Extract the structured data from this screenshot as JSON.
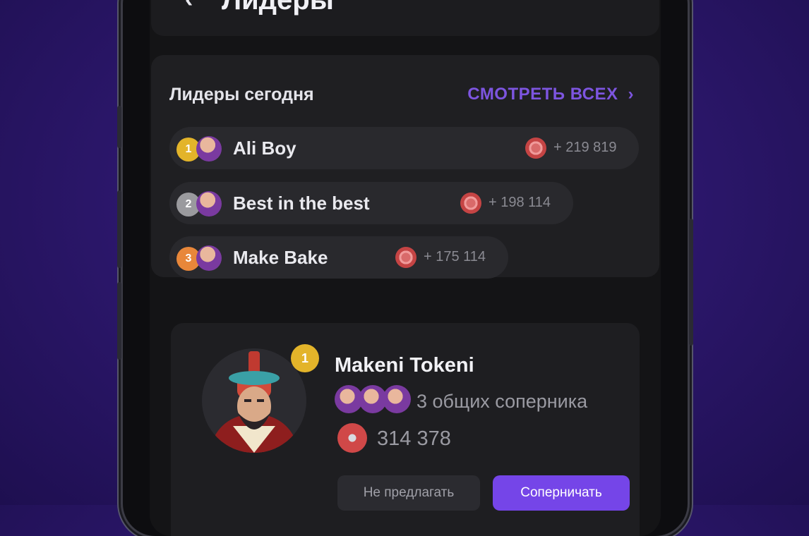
{
  "header": {
    "back_icon": "chevron-left-icon",
    "title": "Лидеры"
  },
  "today": {
    "title": "Лидеры сегодня",
    "see_all": "СМОТРЕТЬ ВСЕХ",
    "leaders": [
      {
        "rank": "1",
        "name": "Ali Boy",
        "score": "+ 219 819",
        "rank_color": "#e3b42a"
      },
      {
        "rank": "2",
        "name": "Best in the best",
        "score": "+ 198 114",
        "rank_color": "#9a9a9e"
      },
      {
        "rank": "3",
        "name": "Make Bake",
        "score": "+ 175 114",
        "rank_color": "#e8873a"
      }
    ]
  },
  "profile": {
    "rank": "1",
    "name": "Makeni Tokeni",
    "rivals_text": "3 общих соперника",
    "coins": "314 378",
    "decline_label": "Не предлагать",
    "accept_label": "Соперничать"
  },
  "colors": {
    "accent": "#7545e8",
    "background": "#2a1668"
  }
}
